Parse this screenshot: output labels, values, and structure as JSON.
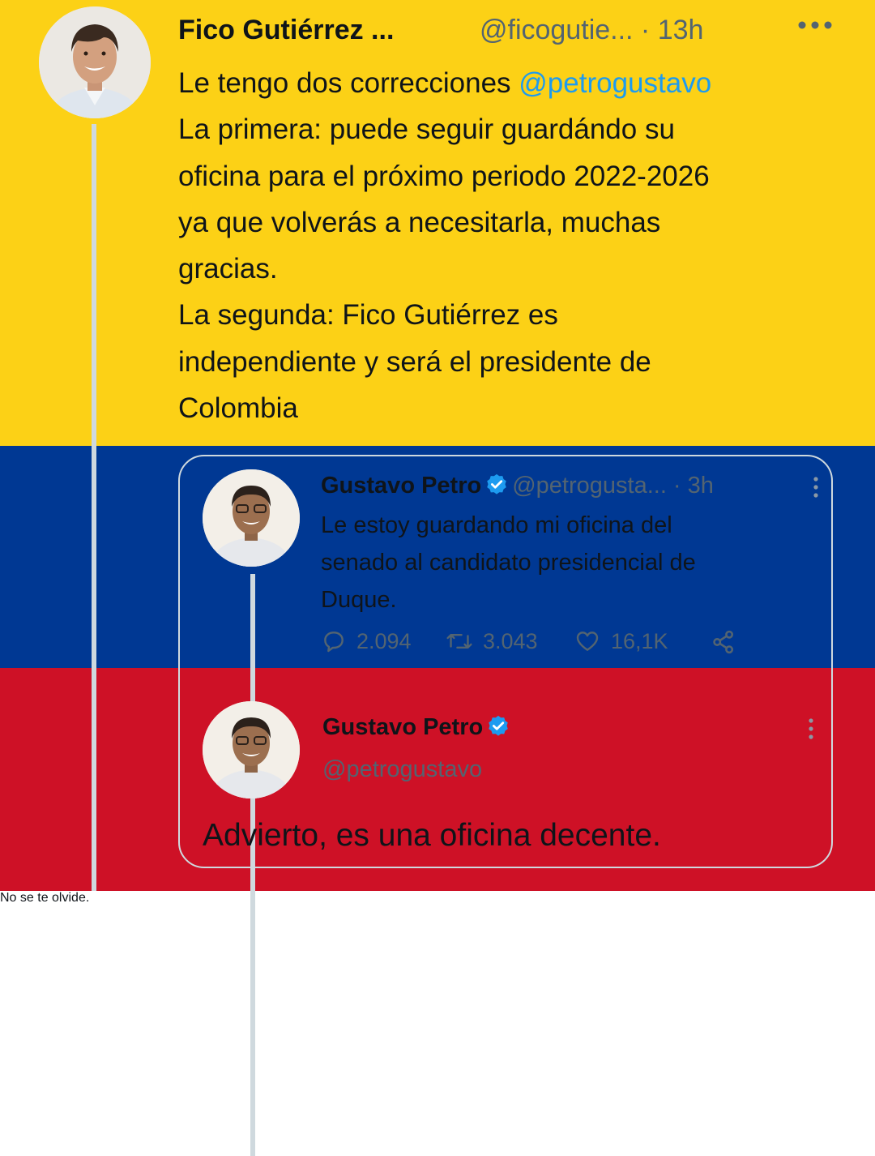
{
  "tweet": {
    "author_name": "Fico Gutiérrez ...",
    "author_handle_time": "@ficogutie... · 13h",
    "text_before_mention": "Le tengo dos correcciones ",
    "mention": "@petrogustavo",
    "text_after_mention": "\nLa primera: puede seguir guardándo su\noficina para el próximo periodo 2022-2026\nya que volverás a necesitarla, muchas\ngracias.\nLa segunda: Fico Gutiérrez es\nindependiente y será el presidente de\nColombia ",
    "text_after_flag": " No se te olvide.",
    "flag_colors": [
      "#fcd116",
      "#003893",
      "#ce1126"
    ]
  },
  "quote": {
    "author_name": "Gustavo Petro",
    "author_handle_time": "@petrogusta... · 3h",
    "text": "Le estoy guardando mi oficina del\nsenado al candidato presidencial de\nDuque.",
    "replies": "2.094",
    "retweets": "3.043",
    "likes": "16,1K",
    "second_author_name": "Gustavo Petro",
    "second_handle": "@petrogustavo",
    "second_text": "Advierto, es una oficina decente."
  },
  "colors": {
    "accent": "#1d9bf0",
    "secondary_text": "#536471",
    "border": "#cfd9de",
    "primary_text": "#0f1419"
  },
  "icons": [
    "more-horizontal-icon",
    "more-vertical-icon",
    "verified-badge-icon",
    "reply-icon",
    "retweet-icon",
    "like-icon",
    "share-icon"
  ]
}
